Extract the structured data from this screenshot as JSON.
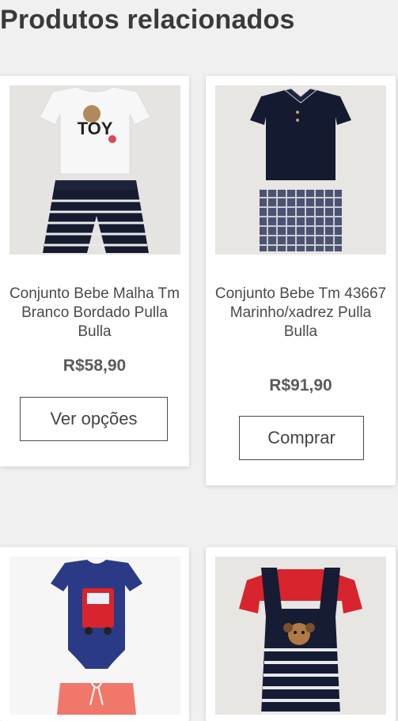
{
  "section": {
    "title": "Produtos relacionados"
  },
  "products": [
    {
      "name": "Conjunto Bebe Malha Tm Branco Bordado Pulla Bulla",
      "price": "R$58,90",
      "button": "Ver opções",
      "image_text": "TOY"
    },
    {
      "name": "Conjunto Bebe Tm 43667 Marinho/xadrez Pulla Bulla",
      "price": "R$91,90",
      "button": "Comprar"
    },
    {
      "name": "",
      "price": "",
      "button": ""
    },
    {
      "name": "",
      "price": "",
      "button": ""
    }
  ],
  "colors": {
    "background": "#f0f0f0",
    "card": "#ffffff",
    "navy": "#151c33",
    "red": "#d8242c",
    "text": "#4a4a4a"
  }
}
